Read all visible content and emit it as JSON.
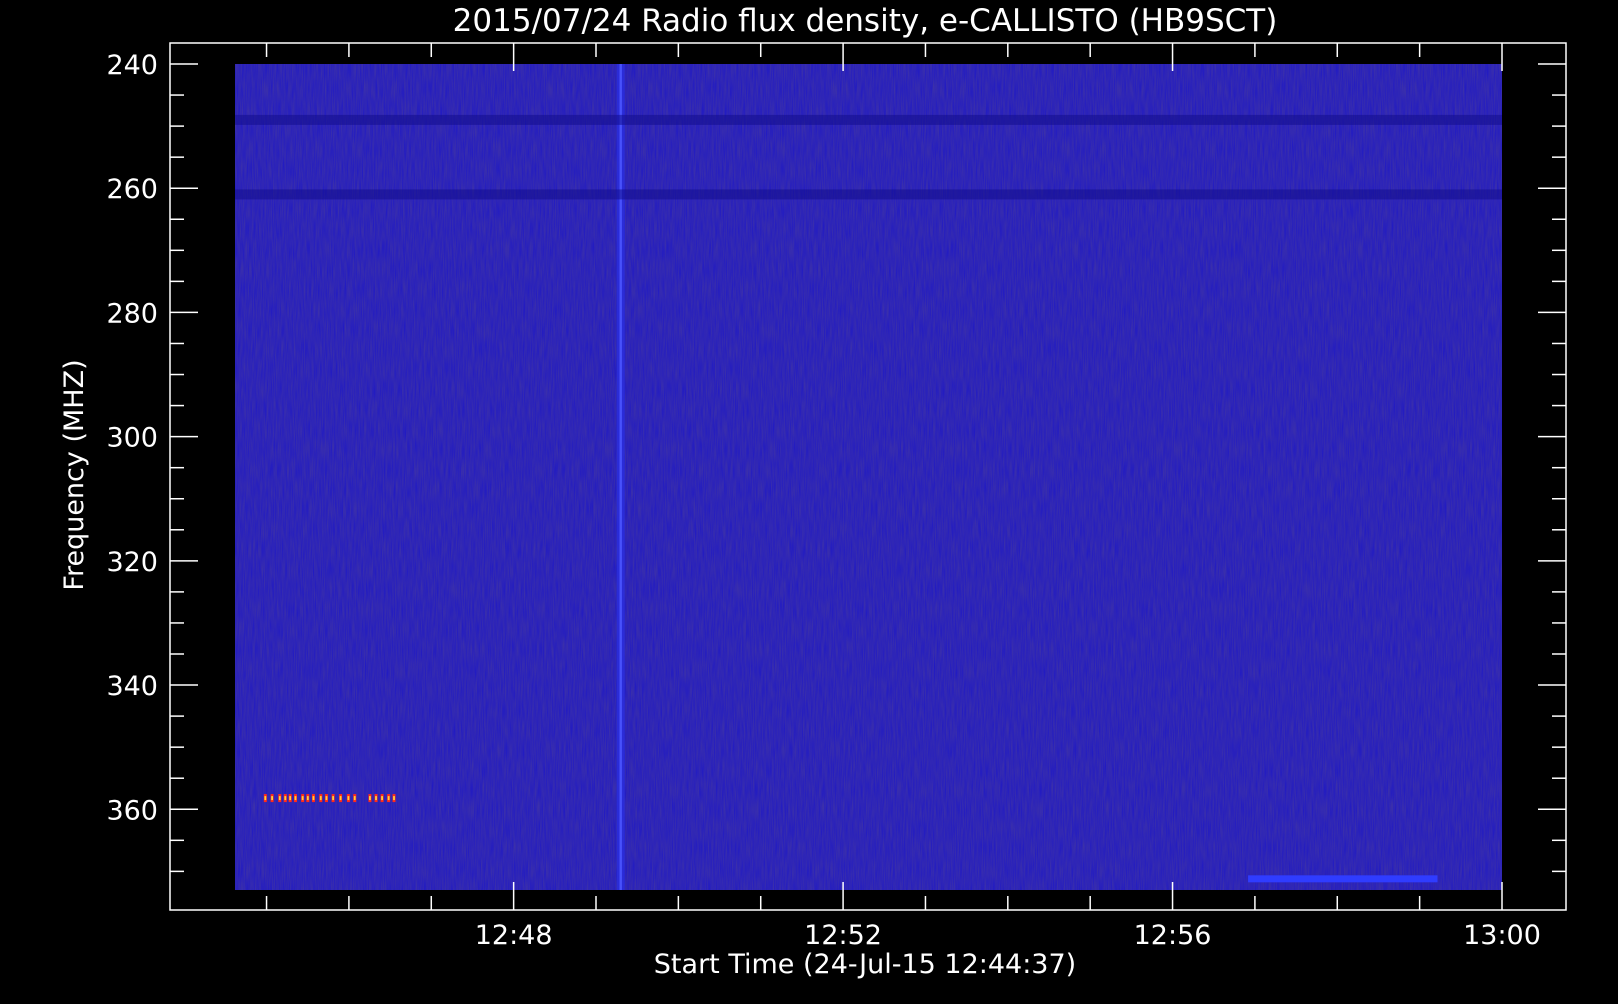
{
  "chart_data": {
    "type": "heatmap",
    "title": "2015/07/24  Radio flux density, e-CALLISTO (HB9SCT)",
    "xlabel": "Start Time (24-Jul-15 12:44:37)",
    "ylabel": "Frequency (MHZ)",
    "x_ticks": [
      "12:48",
      "12:52",
      "12:56",
      "13:00"
    ],
    "x_tick_minutes": [
      3.383,
      7.383,
      11.383,
      15.383
    ],
    "x_range_minutes": [
      0,
      15.383
    ],
    "y_ticks": [
      240,
      260,
      280,
      300,
      320,
      340,
      360
    ],
    "ylim": [
      240,
      373
    ],
    "y_inverted": true,
    "grid": false,
    "colors": {
      "background": "#000000",
      "field": "#1c16c8",
      "axis": "#ffffff",
      "burst": "#ff2a1a",
      "burst_core": "#ffd23c"
    },
    "features": [
      {
        "kind": "vertical-band",
        "minute": 4.683
      },
      {
        "kind": "horizontal-band",
        "freq": 261
      },
      {
        "kind": "horizontal-band",
        "freq": 249
      },
      {
        "kind": "burst-cluster",
        "freq": 358.2,
        "minute_start": 0.35,
        "minute_end": 1.5
      },
      {
        "kind": "burst-cluster",
        "freq": 358.2,
        "minute_start": 1.62,
        "minute_end": 1.93
      },
      {
        "kind": "horizontal-segment",
        "freq": 371.2,
        "minute_start": 12.3,
        "minute_end": 14.6
      }
    ]
  }
}
